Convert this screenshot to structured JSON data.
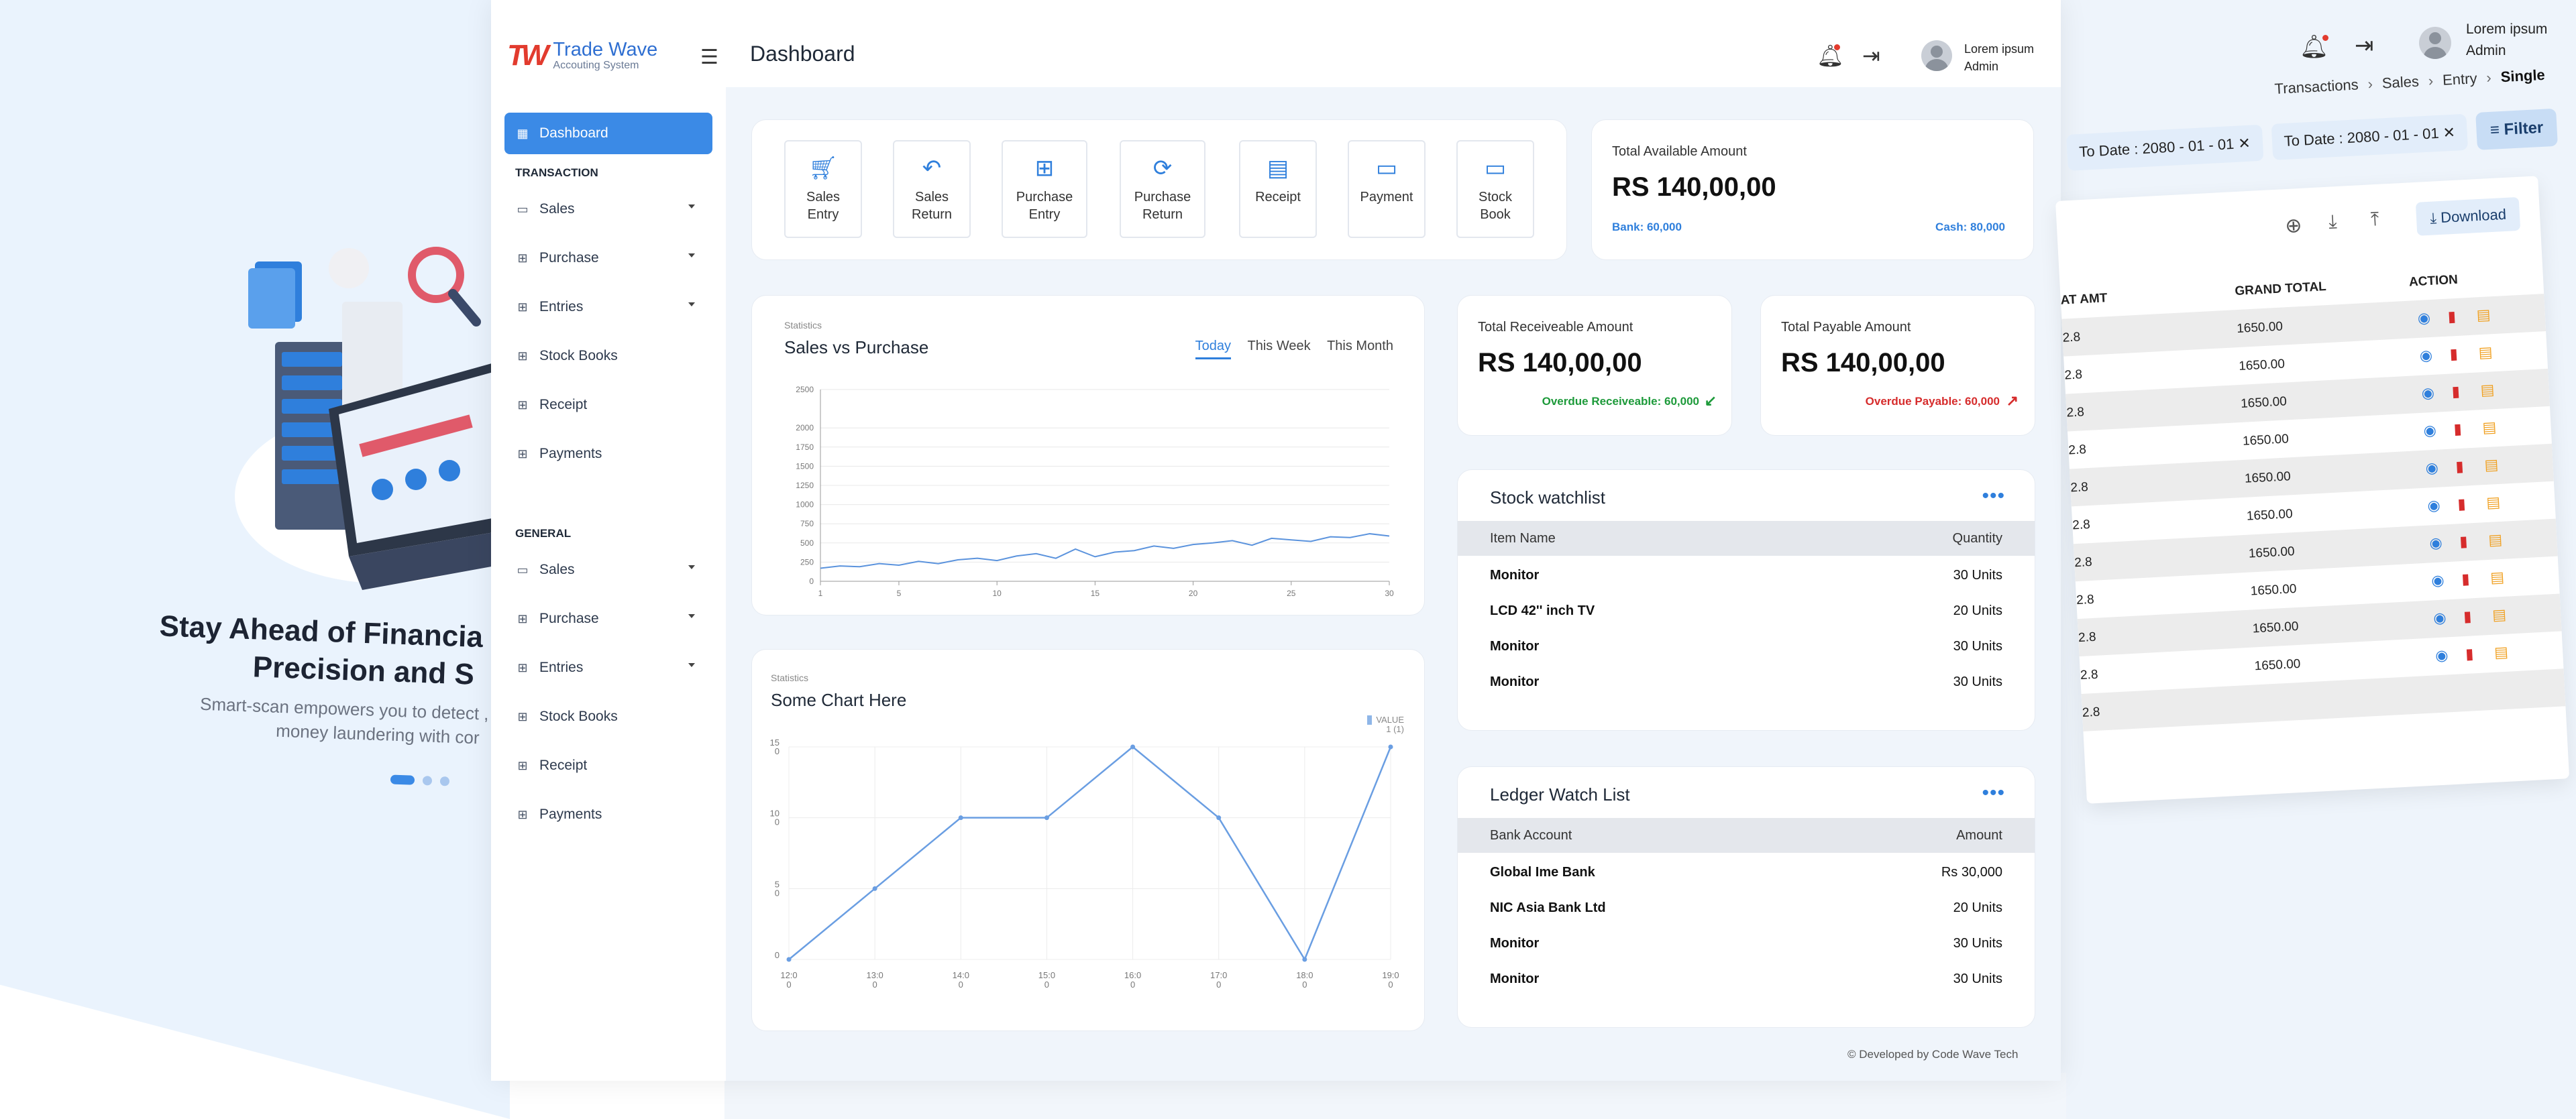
{
  "promo": {
    "title_line1": "Stay Ahead of Financia",
    "title_line2": "Precision and S",
    "sub_line1": "Smart-scan empowers you to detect , p",
    "sub_line2": "money laundering with cor"
  },
  "app": {
    "logo_mark": "TW",
    "logo_title": "Trade Wave",
    "logo_sub": "Accouting System",
    "page_title": "Dashboard",
    "user": {
      "name": "Lorem ipsum",
      "role": "Admin"
    }
  },
  "sidebar": {
    "dashboard": "Dashboard",
    "section_transaction": "TRANSACTION",
    "transaction_items": [
      "Sales",
      "Purchase",
      "Entries",
      "Stock Books",
      "Receipt",
      "Payments"
    ],
    "section_general": "GENERAL",
    "general_items": [
      "Sales",
      "Purchase",
      "Entries",
      "Stock Books",
      "Receipt",
      "Payments"
    ]
  },
  "quick_actions": [
    {
      "line1": "Sales",
      "line2": "Entry",
      "icon": "cart-plus-icon"
    },
    {
      "line1": "Sales",
      "line2": "Return",
      "icon": "undo-icon"
    },
    {
      "line1": "Purchase",
      "line2": "Entry",
      "icon": "add-to-queue-icon"
    },
    {
      "line1": "Purchase",
      "line2": "Return",
      "icon": "refresh-icon"
    },
    {
      "line1": "Receipt",
      "line2": "",
      "icon": "receipt-icon"
    },
    {
      "line1": "Payment",
      "line2": "",
      "icon": "card-icon"
    },
    {
      "line1": "Stock",
      "line2": "Book",
      "icon": "card-icon"
    }
  ],
  "total_available": {
    "label": "Total Available Amount",
    "amount": "RS 140,00,00",
    "bank": "Bank: 60,000",
    "cash": "Cash: 80,000"
  },
  "receivable": {
    "label": "Total Receiveable Amount",
    "amount": "RS 140,00,00",
    "overdue": "Overdue Receiveable: 60,000"
  },
  "payable": {
    "label": "Total Payable Amount",
    "amount": "RS 140,00,00",
    "overdue": "Overdue Payable: 60,000"
  },
  "sales_chart": {
    "kicker": "Statistics",
    "title": "Sales vs Purchase",
    "tabs": [
      "Today",
      "This Week",
      "This Month"
    ]
  },
  "some_chart": {
    "kicker": "Statistics",
    "title": "Some Chart Here",
    "legend_label": "VALUE",
    "legend_sub": "1 (1)"
  },
  "chart_data": [
    {
      "type": "line",
      "x": [
        1,
        2,
        3,
        4,
        5,
        6,
        7,
        8,
        9,
        10,
        11,
        12,
        13,
        14,
        15,
        16,
        17,
        18,
        19,
        20,
        21,
        22,
        23,
        24,
        25,
        26,
        27,
        28,
        29,
        30
      ],
      "series": [
        {
          "values": [
            170,
            200,
            190,
            230,
            210,
            260,
            230,
            280,
            300,
            270,
            330,
            360,
            300,
            420,
            320,
            380,
            400,
            460,
            430,
            480,
            500,
            530,
            470,
            560,
            540,
            520,
            580,
            570,
            620,
            590
          ]
        }
      ],
      "xticks": [
        "1",
        "5",
        "10",
        "15",
        "20",
        "25",
        "30"
      ],
      "yticks": [
        "0",
        "250",
        "500",
        "750",
        "1000",
        "1250",
        "1500",
        "1750",
        "2000",
        "2500"
      ],
      "ylim": [
        0,
        2500
      ],
      "grid": true
    },
    {
      "type": "line",
      "categories": [
        "12:00",
        "13:00",
        "14:00",
        "15:00",
        "16:00",
        "17:00",
        "18:00",
        "19:00"
      ],
      "xticks": [
        "12:0\n0",
        "13:0\n0",
        "14:0\n0",
        "15:0\n0",
        "16:0\n0",
        "17:0\n0",
        "18:0\n0",
        "19:0\n0"
      ],
      "series": [
        {
          "values": [
            0,
            5,
            10,
            10,
            15,
            10,
            0,
            15
          ]
        }
      ],
      "yticks": [
        "0",
        "5\n0",
        "10\n0",
        "15\n0"
      ],
      "ylim": [
        0,
        15
      ],
      "grid": true
    }
  ],
  "stock_watchlist": {
    "title": "Stock watchlist",
    "col1": "Item Name",
    "col2": "Quantity",
    "rows": [
      {
        "name": "Monitor",
        "qty": "30 Units"
      },
      {
        "name": "LCD 42'' inch TV",
        "qty": "20 Units"
      },
      {
        "name": "Monitor",
        "qty": "30 Units"
      },
      {
        "name": "Monitor",
        "qty": "30 Units"
      }
    ]
  },
  "ledger_watchlist": {
    "title": "Ledger Watch List",
    "col1": "Bank Account",
    "col2": "Amount",
    "rows": [
      {
        "name": "Global Ime Bank",
        "amt": "Rs 30,000"
      },
      {
        "name": "NIC Asia Bank Ltd",
        "amt": "20 Units"
      },
      {
        "name": "Monitor",
        "amt": "30 Units"
      },
      {
        "name": "Monitor",
        "amt": "30 Units"
      }
    ]
  },
  "footer": "© Developed by Code Wave Tech",
  "right_panel": {
    "user": {
      "name": "Lorem ipsum",
      "role": "Admin"
    },
    "breadcrumb": [
      "Transactions",
      "Sales",
      "Entry",
      "Single"
    ],
    "chip1": "To Date : 2080 - 01 - 01",
    "chip2": "To Date : 2080 - 01 - 01",
    "filter_label": "Filter",
    "download_label": "Download",
    "columns": [
      "AT AMT",
      "GRAND TOTAL",
      "ACTION"
    ],
    "rows": [
      {
        "a": "2.8",
        "g": "1650.00"
      },
      {
        "a": "2.8",
        "g": "1650.00"
      },
      {
        "a": "2.8",
        "g": "1650.00"
      },
      {
        "a": "2.8",
        "g": "1650.00"
      },
      {
        "a": "2.8",
        "g": "1650.00"
      },
      {
        "a": "2.8",
        "g": "1650.00"
      },
      {
        "a": "2.8",
        "g": "1650.00"
      },
      {
        "a": "2.8",
        "g": "1650.00"
      },
      {
        "a": "2.8",
        "g": "1650.00"
      },
      {
        "a": "2.8",
        "g": "1650.00"
      },
      {
        "a": "2.8",
        "g": ""
      }
    ]
  },
  "colors": {
    "accent": "#3b8ae6",
    "brand_red": "#e23b2e",
    "success": "#1d9a3a",
    "danger": "#d62c2c"
  }
}
